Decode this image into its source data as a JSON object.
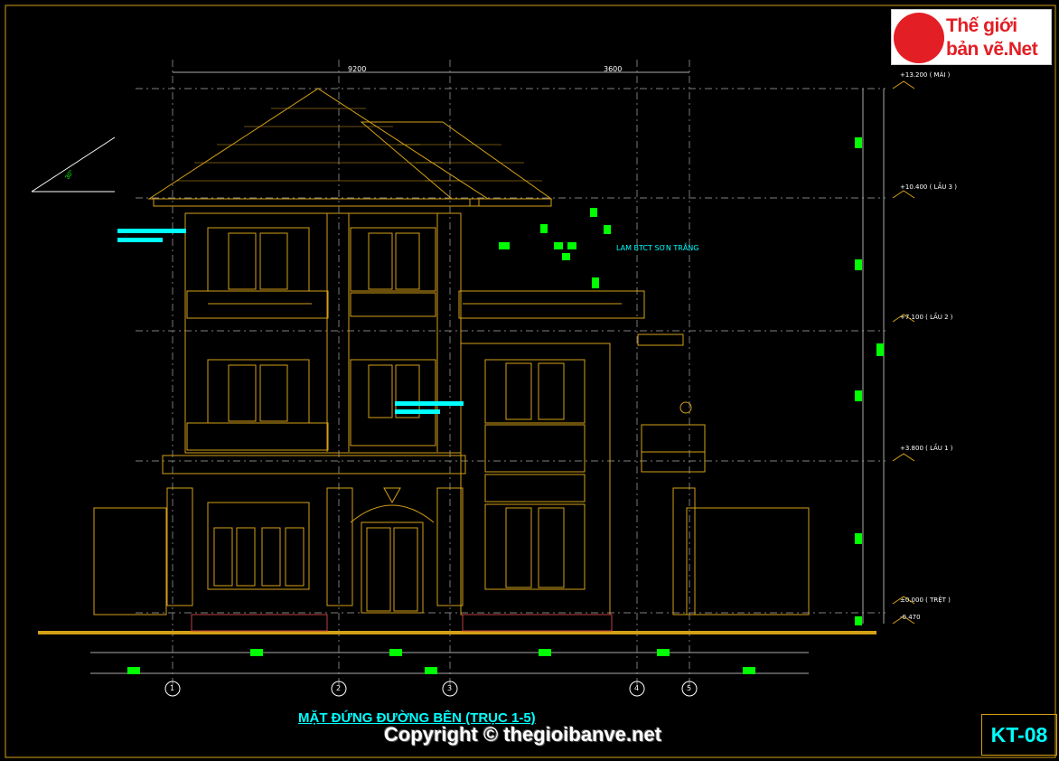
{
  "logo": {
    "line1": "Thế giới",
    "line2": "bản vẽ.Net"
  },
  "drawing": {
    "title": "MẶT ĐỨNG ĐƯỜNG BÊN (TRỤC 1-5)",
    "copyright": "Copyright © thegioibanve.net",
    "sheet": "KT-08",
    "note": "LAM BTCT SƠN TRẮNG",
    "angle": "30°"
  },
  "dimensions": [
    "9200",
    "3600"
  ],
  "levels": [
    {
      "label": "+13.200 ( MÁI )"
    },
    {
      "label": "+10.400 ( LẦU 3 )"
    },
    {
      "label": "+7.100 ( LẦU 2 )"
    },
    {
      "label": "+3.800 ( LẦU 1 )"
    },
    {
      "label": "±0.000 ( TRỆT )"
    },
    {
      "label": "-0.470"
    }
  ],
  "axes": [
    "1",
    "2",
    "3",
    "4",
    "5"
  ],
  "colors": {
    "line": "#d4a017",
    "accent": "#00ffff",
    "marker": "#00ff00",
    "brand": "#e31e24"
  }
}
